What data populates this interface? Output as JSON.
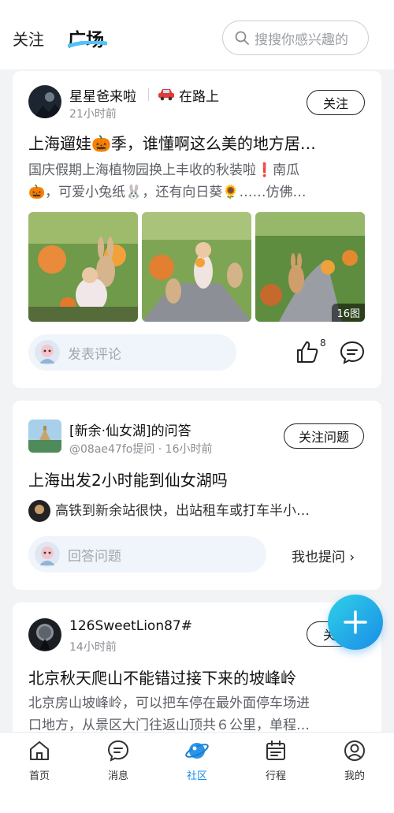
{
  "header": {
    "tab_follow": "关注",
    "tab_square": "广场",
    "search_placeholder": "搜搜你感兴趣的"
  },
  "post1": {
    "author": "星星爸来啦",
    "status_icon": "car-icon",
    "status": "在路上",
    "time": "21小时前",
    "follow_label": "关注",
    "title": "上海遛娃🎃季，谁懂啊这么美的地方居…",
    "desc_line1": "国庆假期上海植物园换上丰收的秋装啦❗南瓜",
    "desc_line2": "🎃，可爱小兔纸🐰，还有向日葵🌻……仿佛…",
    "photo_count": "16图",
    "comment_placeholder": "发表评论",
    "like_count": "8"
  },
  "post2": {
    "group": "[新余·仙女湖]的问答",
    "asker": "@08ae47fo提问 · 16小时前",
    "follow_label": "关注问题",
    "question": "上海出发2小时能到仙女湖吗",
    "answer_preview": "高铁到新余站很快，出站租车或打车半小…",
    "answer_placeholder": "回答问题",
    "ask_label": "我也提问 ›"
  },
  "post3": {
    "author": "126SweetLion87#",
    "time": "14小时前",
    "follow_label": "关注",
    "title": "北京秋天爬山不能错过接下来的坡峰岭",
    "desc_line1": "北京房山坡峰岭，可以把车停在最外面停车场进",
    "desc_line2": "口地方，从景区大门往返山顶共６公里，单程…"
  },
  "nav": {
    "items": [
      {
        "label": "首页",
        "icon": "home-icon"
      },
      {
        "label": "消息",
        "icon": "message-icon"
      },
      {
        "label": "社区",
        "icon": "community-icon"
      },
      {
        "label": "行程",
        "icon": "calendar-icon"
      },
      {
        "label": "我的",
        "icon": "profile-icon"
      }
    ],
    "active_index": 2
  },
  "colors": {
    "accent": "#1a8de6",
    "fab_start": "#2fd0e8",
    "comment_bg": "#f0f4fb"
  }
}
